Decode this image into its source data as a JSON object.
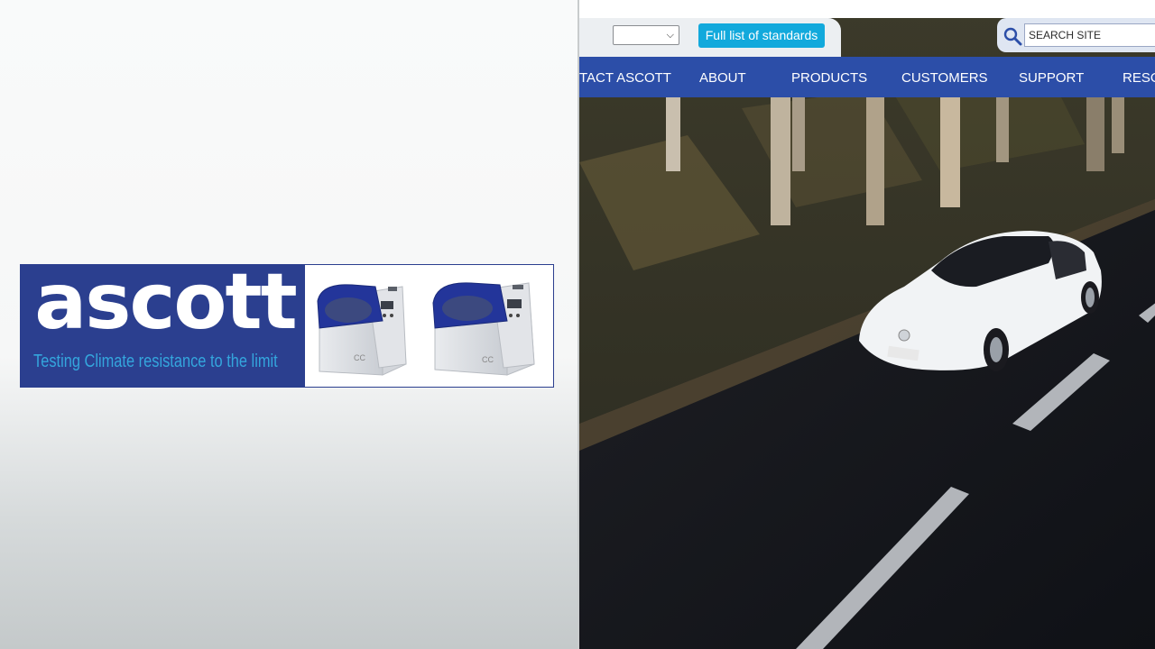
{
  "banner": {
    "logo": "ascott",
    "tagline": "Testing Climate resistance to the limit",
    "colors": {
      "brand_blue": "#2b3f8f",
      "tagline": "#34a6dd"
    }
  },
  "header": {
    "select_value": "",
    "standards_button": "Full list of standards",
    "search_placeholder": "SEARCH SITE",
    "colors": {
      "button": "#12a9dc",
      "nav": "#2c4ea8"
    }
  },
  "nav": {
    "items": [
      {
        "label": "TACT ASCOTT"
      },
      {
        "label": "ABOUT"
      },
      {
        "label": "PRODUCTS"
      },
      {
        "label": "CUSTOMERS"
      },
      {
        "label": "SUPPORT"
      },
      {
        "label": "RESOU"
      }
    ]
  },
  "icons": [
    "search-icon",
    "chevron-down-icon"
  ]
}
